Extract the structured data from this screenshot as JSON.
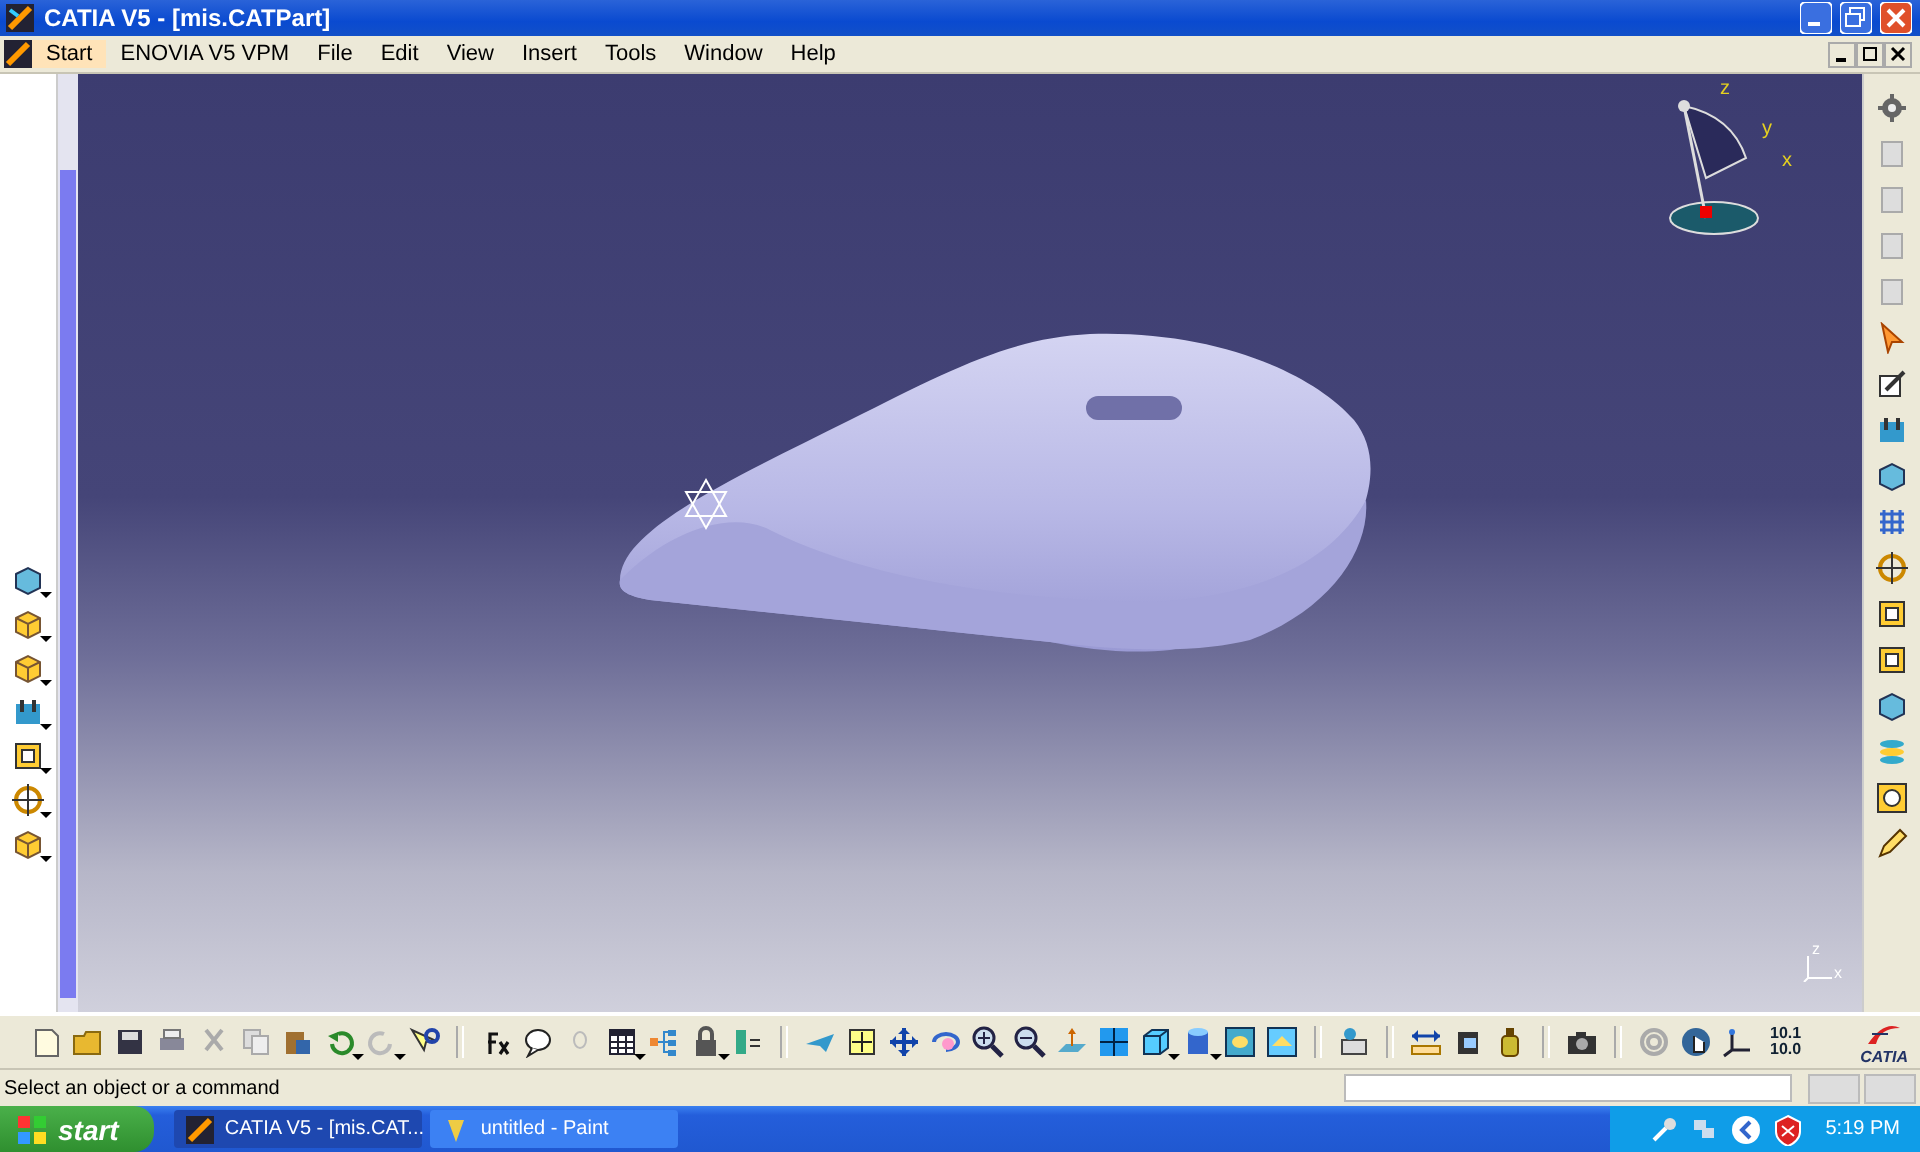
{
  "window": {
    "title": "CATIA V5 - [mis.CATPart]"
  },
  "menu": [
    {
      "label": "Start",
      "selected": true
    },
    {
      "label": "ENOVIA V5 VPM",
      "selected": false
    },
    {
      "label": "File",
      "selected": false
    },
    {
      "label": "Edit",
      "selected": false
    },
    {
      "label": "View",
      "selected": false
    },
    {
      "label": "Insert",
      "selected": false
    },
    {
      "label": "Tools",
      "selected": false
    },
    {
      "label": "Window",
      "selected": false
    },
    {
      "label": "Help",
      "selected": false
    }
  ],
  "compass": {
    "axes": [
      "z",
      "y",
      "x"
    ]
  },
  "corner_axis": {
    "axes": [
      "z",
      "x"
    ]
  },
  "toolbar": {
    "grid_readout": [
      "10.1",
      "10.0"
    ],
    "logo": "CATIA"
  },
  "status_bar": {
    "message": "Select an object or a command"
  },
  "taskbar": {
    "start": "start",
    "tasks": [
      {
        "label": "CATIA V5 - [mis.CAT...",
        "selected": true
      },
      {
        "label": "untitled - Paint",
        "selected": false
      }
    ],
    "clock": "5:19 PM"
  }
}
